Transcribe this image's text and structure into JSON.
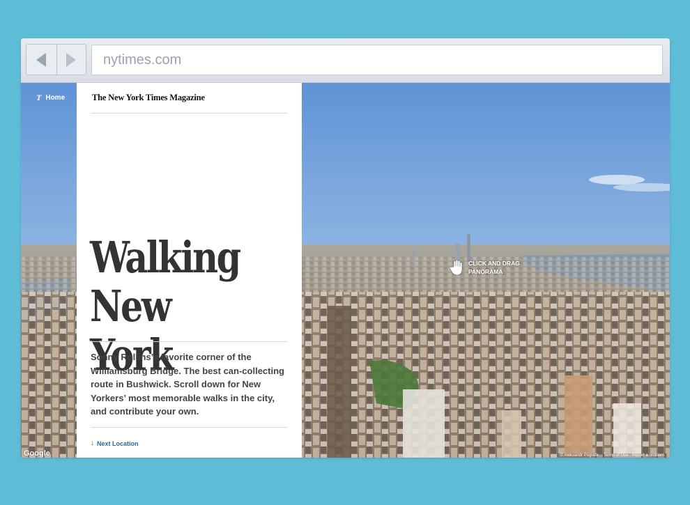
{
  "browser": {
    "url": "nytimes.com",
    "back_button": "back",
    "forward_button": "forward"
  },
  "page": {
    "home_link": "Home",
    "brand_glyph": "T",
    "masthead": "The New York Times Magazine",
    "headline_line1": "Walking",
    "headline_line2": "New York",
    "dek": "Sonny Rollins’s favorite corner of the Williamsburg Bridge. The best can-collecting route in Bushwick. Scroll down for New Yorkers’ most memorable walks in the city, and contribute your own.",
    "next_location": "Next Location",
    "next_arrow": "↓",
    "drag_hint_line1": "CLICK AND DRAG",
    "drag_hint_line2": "PANORAMA",
    "map_provider": "Google",
    "credits": "© Aleksandr Pogrebi… Terms of Use · Report a problem"
  },
  "colors": {
    "background": "#5fbcd6",
    "link": "#326891",
    "headline": "#333333",
    "sky": "#6f9fd8"
  },
  "icons": [
    "chevron-left-icon",
    "chevron-right-icon",
    "nyt-t-icon",
    "hand-drag-icon",
    "arrow-down-icon"
  ]
}
